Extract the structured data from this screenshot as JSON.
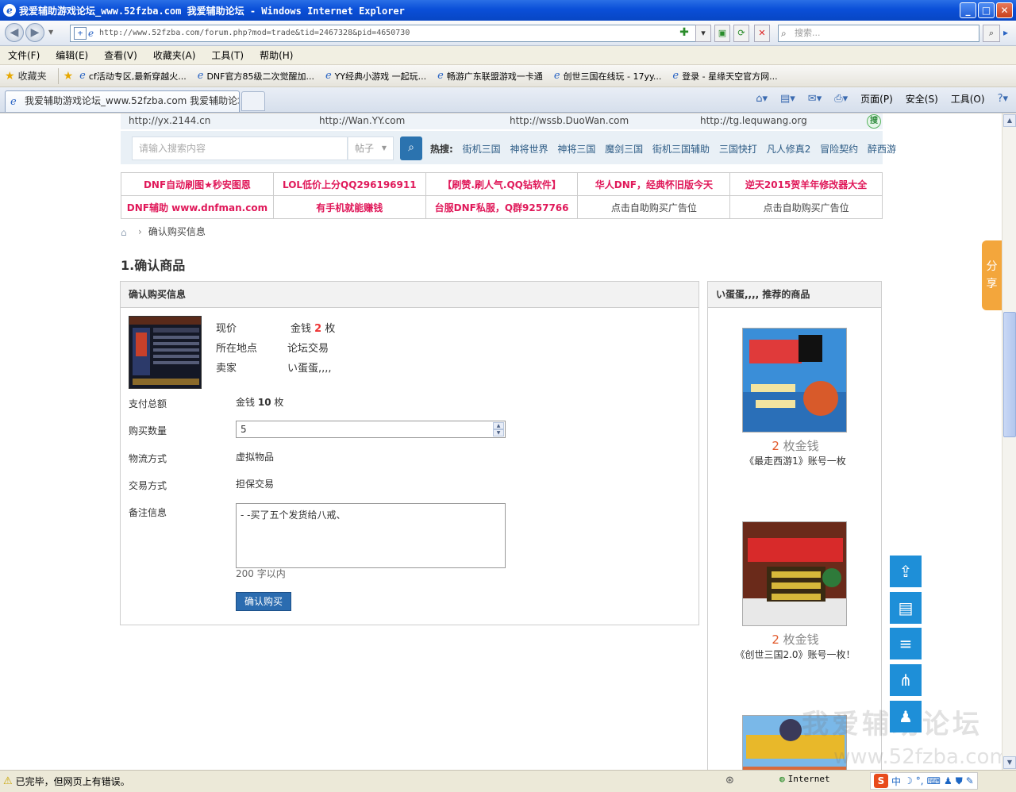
{
  "window": {
    "title": "我爱辅助游戏论坛_www.52fzba.com 我爱辅助论坛 - Windows Internet Explorer",
    "min": "_",
    "max": "□",
    "close": "✕"
  },
  "nav": {
    "url": "http://www.52fzba.com/forum.php?mod=trade&tid=2467328&pid=4650730",
    "search_placeholder": "搜索..."
  },
  "menu": [
    "文件(F)",
    "编辑(E)",
    "查看(V)",
    "收藏夹(A)",
    "工具(T)",
    "帮助(H)"
  ],
  "favorites": {
    "label": "收藏夹",
    "items": [
      "cf活动专区,最新穿越火...",
      "DNF官方85级二次觉醒加...",
      "YY经典小游戏  一起玩...",
      "畅游广东联盟游戏一卡通",
      "创世三国在线玩 - 17yy...",
      "登录 - 星缘天空官方网..."
    ]
  },
  "tab": {
    "title": "我爱辅助游戏论坛_www.52fzba.com 我爱辅助论坛"
  },
  "commandbar": {
    "page": "页面(P)",
    "safety": "安全(S)",
    "tools": "工具(O)"
  },
  "top_links": [
    "http://yx.2144.cn",
    "http://Wan.YY.com",
    "http://wssb.DuoWan.com",
    "http://tg.lequwang.org"
  ],
  "search": {
    "placeholder": "请输入搜索内容",
    "scope": "帖子",
    "hot_label": "热搜:",
    "hot": [
      "街机三国",
      "神将世界",
      "神将三国",
      "魔剑三国",
      "街机三国辅助",
      "三国快打",
      "凡人修真2",
      "冒险契约",
      "醉西游"
    ]
  },
  "ads": [
    [
      {
        "text": "DNF自动刷图★秒安图恩",
        "color": "#e0195a"
      },
      {
        "text": "LOL低价上分QQ296196911",
        "color": "#e0195a"
      },
      {
        "text": "【刷赞.刷人气.QQ钻软件】",
        "color": "#e0195a"
      },
      {
        "text": "华人DNF，经典怀旧版今天",
        "color": "#e0195a"
      },
      {
        "text": "逆天2015贺羊年修改器大全",
        "color": "#e0195a"
      }
    ],
    [
      {
        "text": "DNF辅助 www.dnfman.com",
        "color": "#e0195a"
      },
      {
        "text": "有手机就能赚钱",
        "color": "#e0195a"
      },
      {
        "text": "台服DNF私服，Q群9257766",
        "color": "#e0195a"
      },
      {
        "text": "点击自助购买广告位",
        "color": "#444444"
      },
      {
        "text": "点击自助购买广告位",
        "color": "#444444"
      }
    ]
  ],
  "breadcrumb": {
    "current": "确认购买信息"
  },
  "step_title": "1.确认商品",
  "order": {
    "box_title": "确认购买信息",
    "price_label": "现价",
    "price_prefix": "金钱",
    "price_value": "2",
    "price_unit": "枚",
    "location_label": "所在地点",
    "location_value": "论坛交易",
    "seller_label": "卖家",
    "seller_value": "い蛋蛋,,,,",
    "total_label": "支付总额",
    "total_prefix": "金钱",
    "total_value": "10",
    "total_unit": "枚",
    "qty_label": "购买数量",
    "qty_value": "5",
    "shipping_label": "物流方式",
    "shipping_value": "虚拟物品",
    "trade_label": "交易方式",
    "trade_value": "担保交易",
    "memo_label": "备注信息",
    "memo_value": "- -买了五个发货给八戒、",
    "memo_hint": "200 字以内",
    "confirm": "确认购买"
  },
  "recommend": {
    "title": "い蛋蛋,,,, 推荐的商品",
    "items": [
      {
        "price": "2",
        "unit": "枚金钱",
        "name": "《最走西游1》账号一枚"
      },
      {
        "price": "2",
        "unit": "枚金钱",
        "name": "《创世三国2.0》账号一枚！"
      }
    ]
  },
  "share": "分享",
  "watermark": {
    "line1": "我爱辅助论坛",
    "line2": "www.52fzba.com"
  },
  "status": {
    "text": "已完毕，但网页上有错误。",
    "zone": "Internet",
    "ime": "中"
  },
  "colors": {
    "accent": "#2b6cb0",
    "price": "#e33333",
    "float": "#1e8fd8",
    "share": "#f3a63c"
  }
}
